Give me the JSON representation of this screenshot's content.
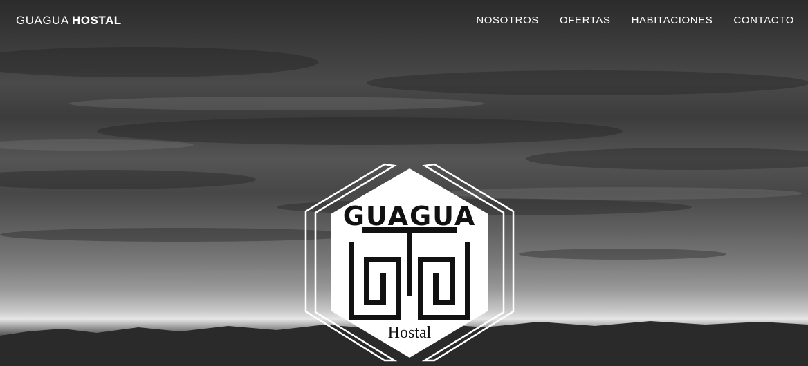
{
  "navbar": {
    "brand_light": "GUAGUA",
    "brand_bold": "HOSTAL",
    "links": [
      {
        "label": "NOSOTROS"
      },
      {
        "label": "OFERTAS"
      },
      {
        "label": "HABITACIONES"
      },
      {
        "label": "CONTACTO"
      }
    ]
  },
  "hero": {
    "logo_text_top": "GUAGUA",
    "logo_text_bottom": "Hostal"
  },
  "colors": {
    "nav_text": "#ffffff",
    "logo_fill": "#ffffff",
    "logo_mark": "#111111"
  }
}
